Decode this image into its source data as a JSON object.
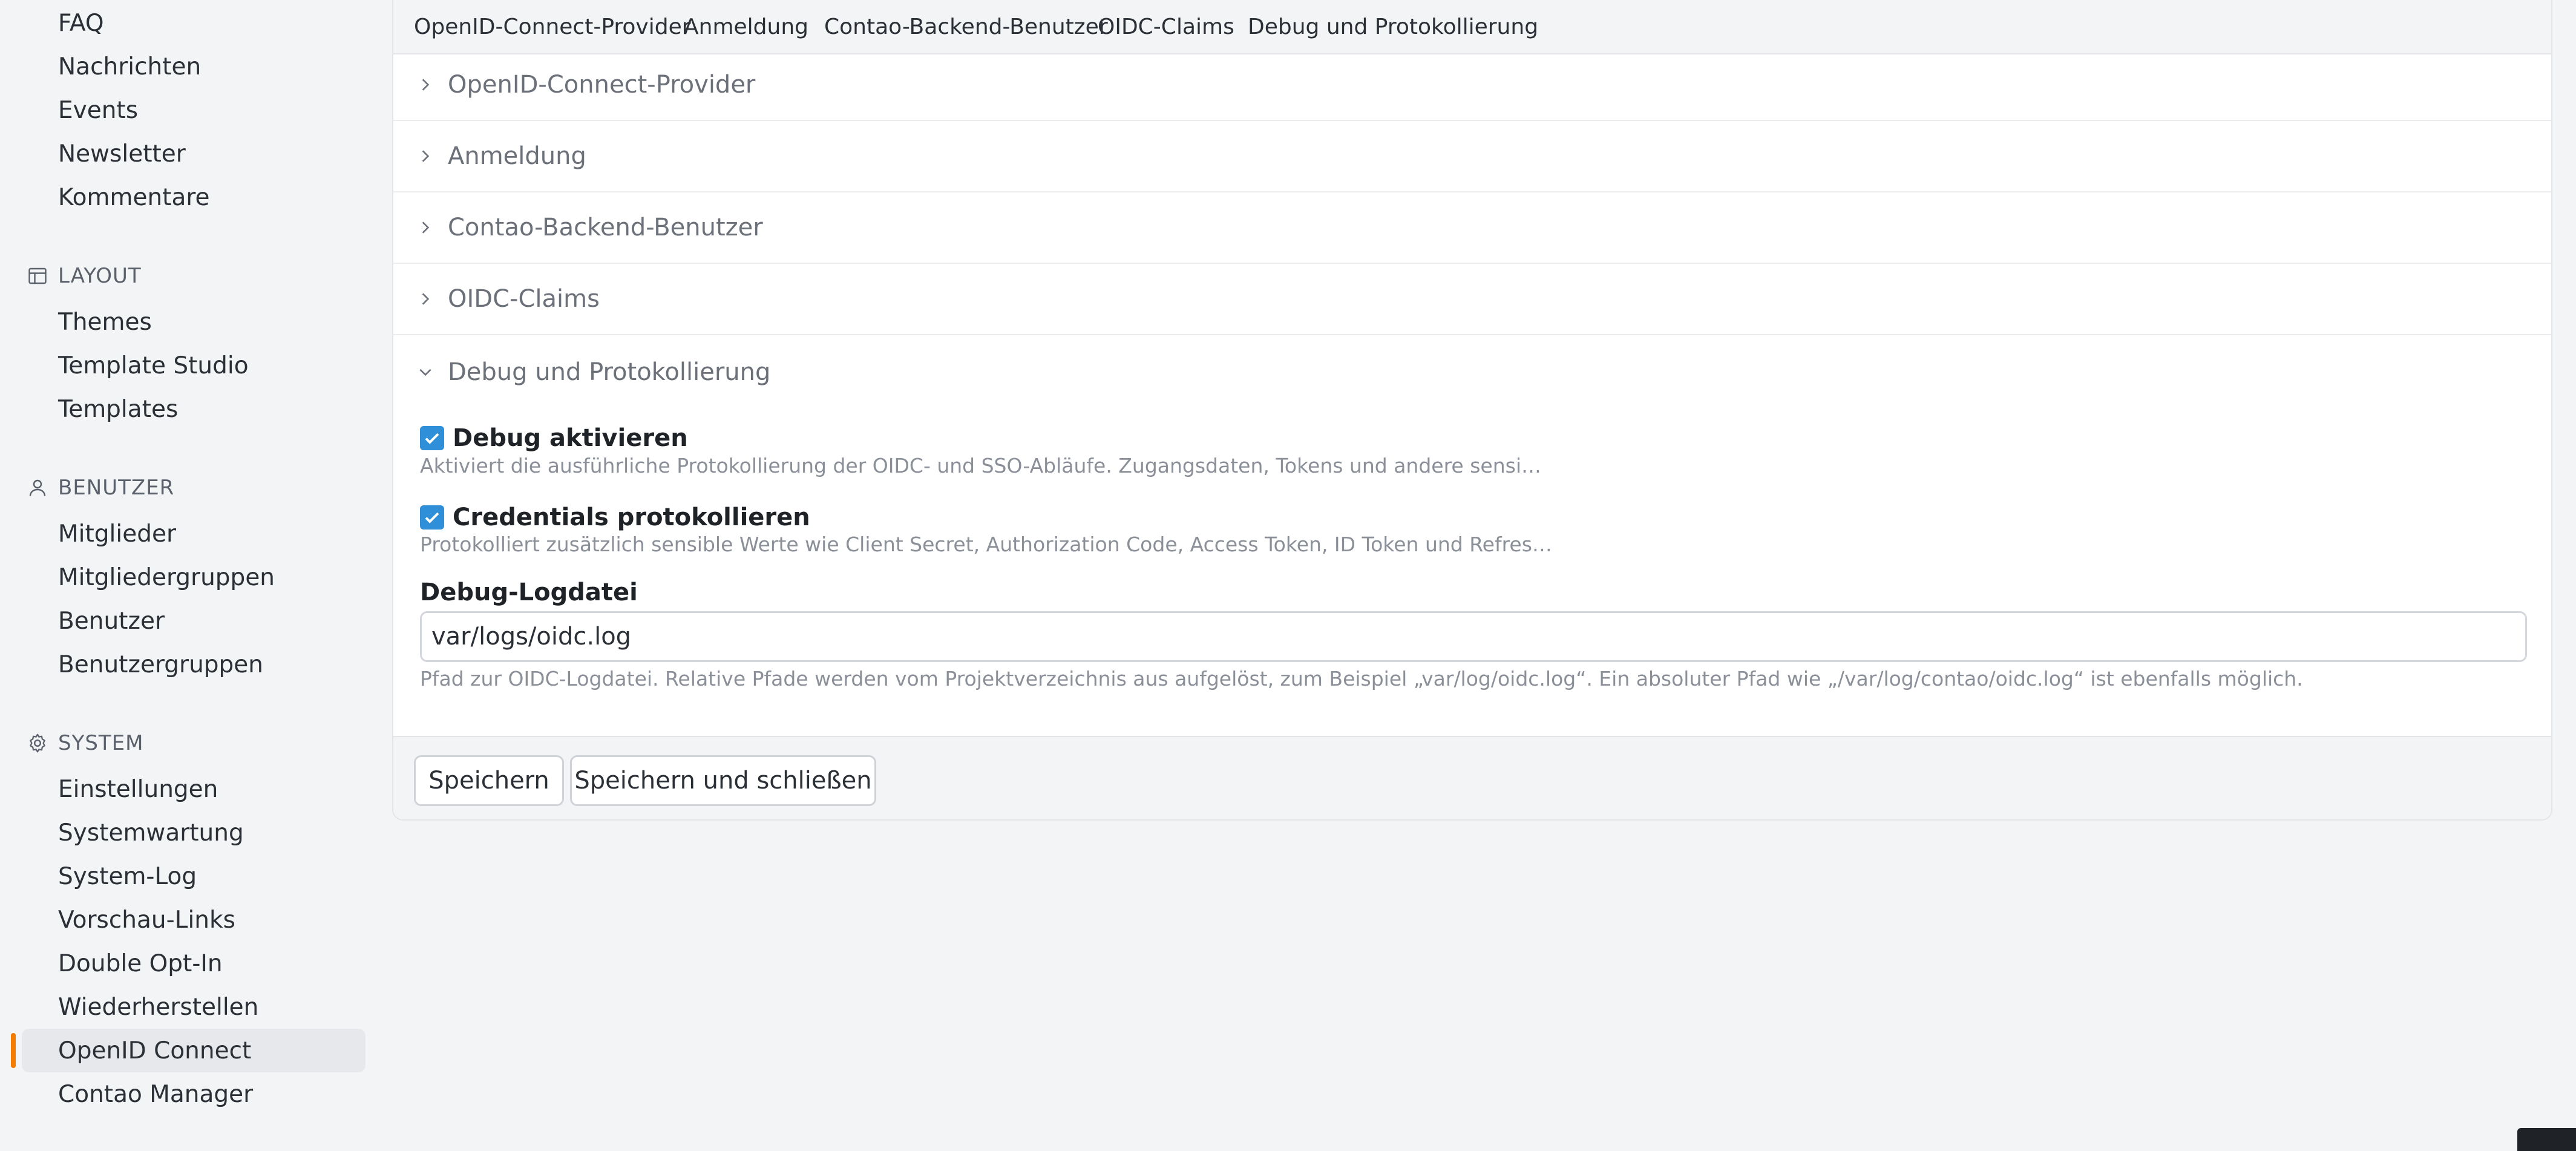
{
  "sidebar": {
    "content_items": [
      "FAQ",
      "Nachrichten",
      "Events",
      "Newsletter",
      "Kommentare"
    ],
    "layout": {
      "title": "LAYOUT",
      "icon": "layout-icon",
      "items": [
        "Themes",
        "Template Studio",
        "Templates"
      ]
    },
    "users": {
      "title": "BENUTZER",
      "icon": "user-icon",
      "items": [
        "Mitglieder",
        "Mitgliedergruppen",
        "Benutzer",
        "Benutzergruppen"
      ]
    },
    "system": {
      "title": "SYSTEM",
      "icon": "gear-icon",
      "items": [
        "Einstellungen",
        "Systemwartung",
        "System-Log",
        "Vorschau-Links",
        "Double Opt-In",
        "Wiederherstellen",
        "OpenID Connect",
        "Contao Manager"
      ]
    },
    "active_item": "OpenID Connect",
    "accent_color": "#f47c00"
  },
  "tabs": [
    "OpenID-Connect-Provider",
    "Anmeldung",
    "Contao-Backend-Benutzer",
    "OIDC-Claims",
    "Debug und Protokollierung"
  ],
  "sections": [
    {
      "label": "OpenID-Connect-Provider",
      "expanded": false
    },
    {
      "label": "Anmeldung",
      "expanded": false
    },
    {
      "label": "Contao-Backend-Benutzer",
      "expanded": false
    },
    {
      "label": "OIDC-Claims",
      "expanded": false
    },
    {
      "label": "Debug und Protokollierung",
      "expanded": true
    }
  ],
  "debug": {
    "enable_label": "Debug aktivieren",
    "enable_checked": true,
    "enable_help": "Aktiviert die ausführliche Protokollierung der OIDC- und SSO-Abläufe. Zugangsdaten, Tokens und andere sensi…",
    "credentials_label": "Credentials protokollieren",
    "credentials_checked": true,
    "credentials_help": "Protokolliert zusätzlich sensible Werte wie Client Secret, Authorization Code, Access Token, ID Token und Refres…",
    "logfile_label": "Debug-Logdatei",
    "logfile_value": "var/logs/oidc.log",
    "logfile_help": "Pfad zur OIDC-Logdatei. Relative Pfade werden vom Projektverzeichnis aus aufgelöst, zum Beispiel „var/log/oidc.log“. Ein absoluter Pfad wie „/var/log/contao/oidc.log“ ist ebenfalls möglich."
  },
  "buttons": {
    "save": "Speichern",
    "save_close": "Speichern und schließen"
  },
  "colors": {
    "checkbox": "#2f8fd8"
  }
}
